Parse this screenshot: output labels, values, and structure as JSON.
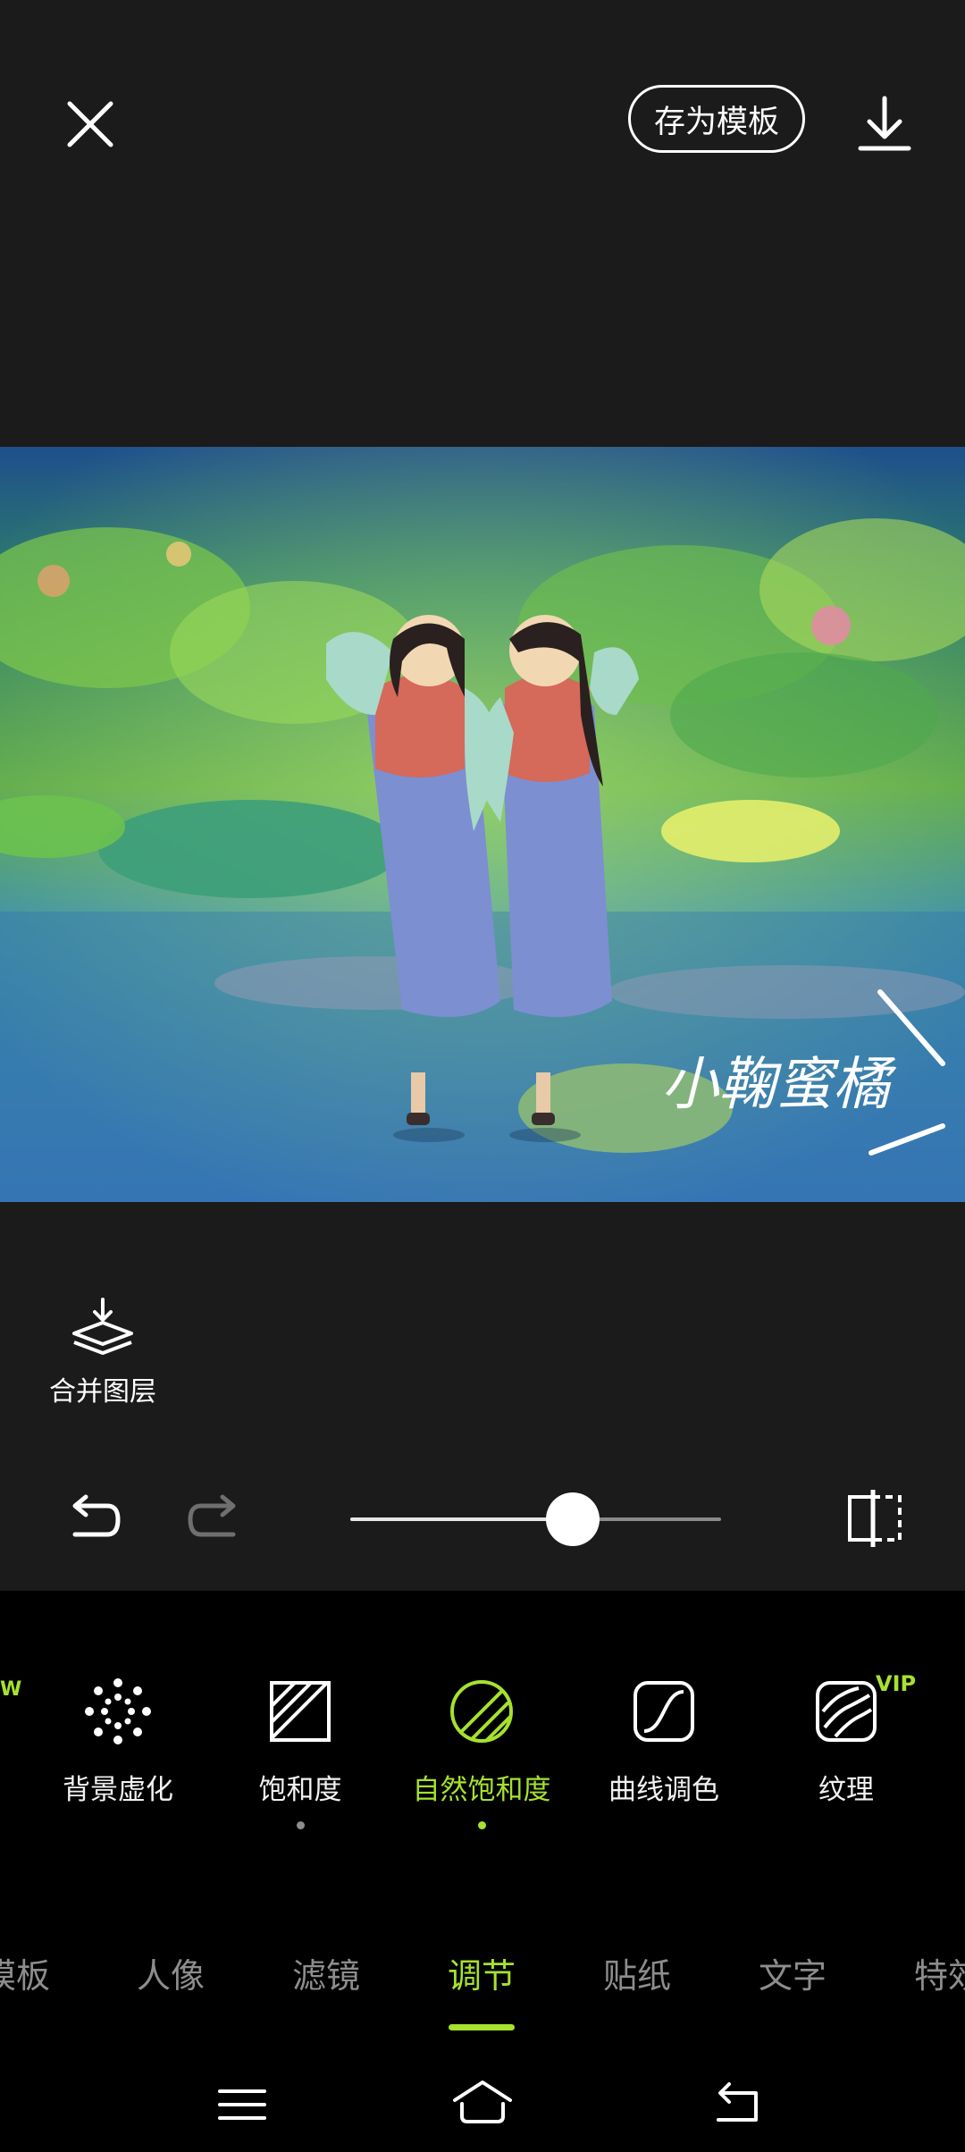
{
  "header": {
    "save_template_label": "存为模板",
    "close_icon": "close-icon",
    "download_icon": "download-icon"
  },
  "canvas": {
    "watermark_text": "小鞠蜜橘"
  },
  "merge_layer": {
    "label": "合并图层",
    "icon": "merge-layers-icon"
  },
  "controls": {
    "undo_icon": "undo-icon",
    "redo_icon": "redo-icon",
    "slider_value_fraction": 0.6,
    "compare_icon": "compare-icon"
  },
  "tools": [
    {
      "label": "背景虚化",
      "icon": "blur-dots-icon"
    },
    {
      "label": "饱和度",
      "icon": "saturation-icon"
    },
    {
      "label": "自然饱和度",
      "icon": "vibrance-icon"
    },
    {
      "label": "曲线调色",
      "icon": "curve-icon"
    },
    {
      "label": "纹理",
      "icon": "texture-icon"
    }
  ],
  "vip_badge": "VIP",
  "partial_left_badge": "W",
  "tabs": [
    "模板",
    "人像",
    "滤镜",
    "调节",
    "贴纸",
    "文字",
    "特效"
  ],
  "active_tab": "调节",
  "colors": {
    "accent": "#a6e22e",
    "background": "#1b1b1b",
    "tool_panel": "#000000"
  }
}
